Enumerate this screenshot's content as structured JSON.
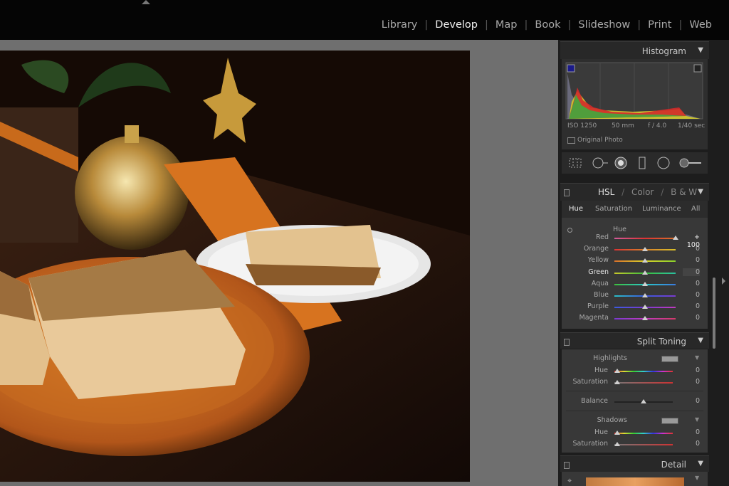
{
  "modules": [
    {
      "label": "Library",
      "active": false
    },
    {
      "label": "Develop",
      "active": true
    },
    {
      "label": "Map",
      "active": false
    },
    {
      "label": "Book",
      "active": false
    },
    {
      "label": "Slideshow",
      "active": false
    },
    {
      "label": "Print",
      "active": false
    },
    {
      "label": "Web",
      "active": false
    }
  ],
  "histogram": {
    "title": "Histogram",
    "iso": "ISO 1250",
    "focal": "50 mm",
    "aperture": "f / 4.0",
    "shutter": "1/40 sec",
    "original_label": "Original Photo"
  },
  "hsl": {
    "header": {
      "hsl": "HSL",
      "sep1": "/",
      "color": "Color",
      "sep2": "/",
      "bw": "B & W"
    },
    "tabs": [
      "Hue",
      "Saturation",
      "Luminance",
      "All"
    ],
    "section_label": "Hue",
    "rows": [
      {
        "label": "Red",
        "value": "+ 100",
        "pos": 1.0
      },
      {
        "label": "Orange",
        "value": "0",
        "pos": 0.5
      },
      {
        "label": "Yellow",
        "value": "0",
        "pos": 0.5
      },
      {
        "label": "Green",
        "value": "0",
        "pos": 0.5
      },
      {
        "label": "Aqua",
        "value": "0",
        "pos": 0.5
      },
      {
        "label": "Blue",
        "value": "0",
        "pos": 0.5
      },
      {
        "label": "Purple",
        "value": "0",
        "pos": 0.5
      },
      {
        "label": "Magenta",
        "value": "0",
        "pos": 0.5
      }
    ]
  },
  "split_toning": {
    "title": "Split Toning",
    "highlights": "Highlights",
    "hue_label": "Hue",
    "hue_value": "0",
    "sat_label": "Saturation",
    "sat_value": "0",
    "balance_label": "Balance",
    "balance_value": "0",
    "shadows": "Shadows",
    "sh_hue_label": "Hue",
    "sh_hue_value": "0",
    "sh_sat_label": "Saturation",
    "sh_sat_value": "0"
  },
  "detail": {
    "title": "Detail"
  },
  "colors": {
    "accent": "#f0f0f0",
    "panel": "#383838",
    "header": "#282828"
  }
}
